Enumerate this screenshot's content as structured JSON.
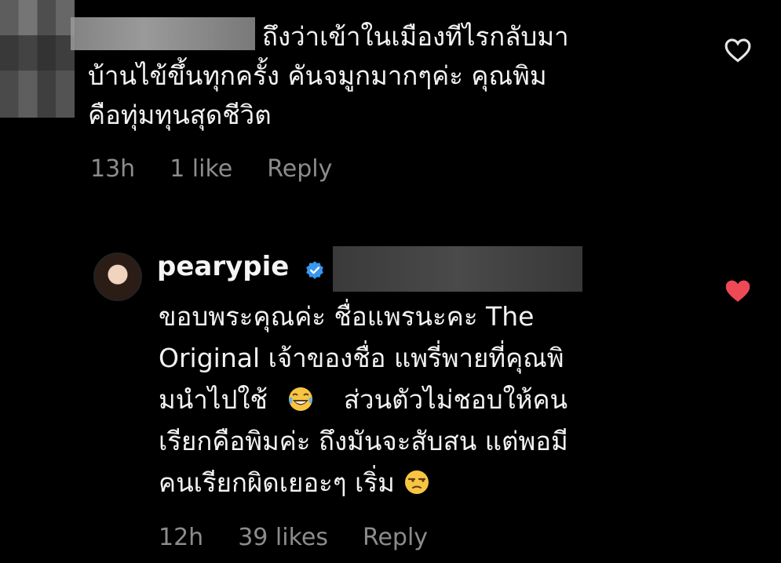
{
  "comment1": {
    "text_lines": [
      "ถึงว่าเข้าในเมืองทีไรกลับมา",
      "บ้านไข้ขึ้นทุกครั้ง คันจมูกมากๆค่ะ คุณพิม",
      "คือทุ่มทุนสุดชีวิต"
    ],
    "time": "13h",
    "likes": "1 like",
    "reply": "Reply"
  },
  "comment2": {
    "username": "pearypie",
    "text_lines": [
      "ขอบพระคุณค่ะ ชื่อแพรนะคะ The",
      "Original เจ้าของชื่อ แพรี่พายที่คุณพิ",
      "มนำไปใช้",
      "ส่วนตัวไม่ชอบให้คน",
      "เรียกคือพิมค่ะ ถึงมันจะสับสน แต่พอมี",
      "คนเรียกผิดเยอะๆ เริ่ม"
    ],
    "time": "12h",
    "likes": "39 likes",
    "reply": "Reply"
  },
  "icons": {
    "heart_outline": "heart-outline-icon",
    "heart_filled": "heart-filled-icon",
    "verified": "verified-badge-icon",
    "laugh_emoji": "tears-of-joy-emoji",
    "unamused_emoji": "unamused-face-emoji"
  },
  "colors": {
    "background": "#000000",
    "text": "#f2f2f2",
    "meta": "#8c8c8c",
    "liked_heart": "#ed4956",
    "verified": "#3897f0"
  }
}
